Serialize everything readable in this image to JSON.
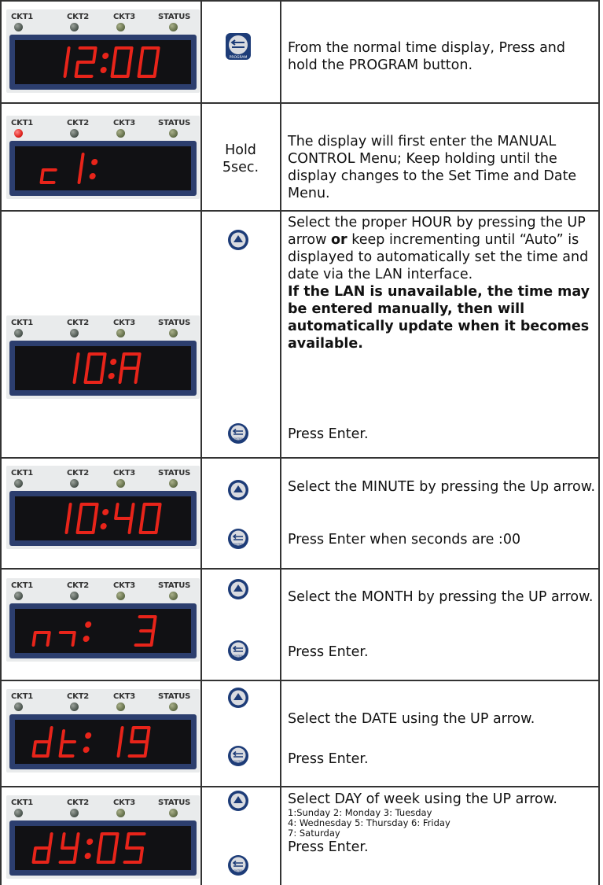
{
  "panel_labels": [
    "CKT1",
    "CKT2",
    "CKT3",
    "STATUS"
  ],
  "enter_button_label": "ENTER",
  "program_button_label": "PROGRAM",
  "rows": [
    {
      "display": "12:00",
      "text": "From the normal time display, Press and hold the PROGRAM button."
    },
    {
      "display": "c 1:",
      "hold": "Hold",
      "hold2": "5sec.",
      "text": "The display will first enter the MANUAL CONTROL Menu; Keep holding until the display changes to the Set Time and Date Menu."
    },
    {
      "display": "10:A",
      "text_a": "Select the proper HOUR by pressing the UP arrow ",
      "text_bold_or": "or",
      "text_b": " keep incrementing until “Auto” is displayed to automatically set the time and date via the LAN interface.",
      "bold_note": "If the LAN is unavailable, the time may be entered manually, then will automatically update when it becomes available.",
      "enter_text": "Press Enter."
    },
    {
      "display": "10:40",
      "text": "Select the MINUTE by pressing the Up arrow.",
      "enter_text": "Press Enter when seconds are :00"
    },
    {
      "display": "m: 3",
      "text": "Select the MONTH by pressing the UP arrow.",
      "enter_text": "Press Enter."
    },
    {
      "display": "dt: 19",
      "text": "Select the DATE using the UP arrow.",
      "enter_text": "Press Enter."
    },
    {
      "display": "dy:05",
      "text": "Select DAY of week using the UP arrow.",
      "days_line1": "1:Sunday  2: Monday  3: Tuesday",
      "days_line2": "4: Wednesday  5: Thursday  6: Friday",
      "days_line3": "7: Saturday",
      "enter_text": "Press Enter."
    }
  ]
}
